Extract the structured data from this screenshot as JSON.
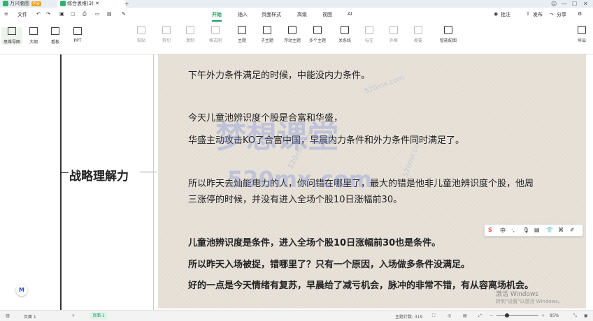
{
  "titlebar": {
    "app_tab": "万兴脑图",
    "pro_badge": "Pro",
    "doc_tab": "综合思维(3)",
    "add_tab": "+"
  },
  "menubar": {
    "file": "文件",
    "tabs": [
      "开始",
      "插入",
      "页面样式",
      "高级",
      "视图",
      "AI"
    ],
    "active_tab": "开始",
    "right": {
      "review": "批注",
      "publish": "发布",
      "share": "分享"
    }
  },
  "toolbar": {
    "views": [
      "思维导图",
      "大纲",
      "看板",
      "PPT"
    ],
    "tools": [
      "粘贴",
      "剪切",
      "复制",
      "格式刷",
      "主题",
      "子主题",
      "浮动主题",
      "多个主题",
      "关系线",
      "标注",
      "外框",
      "概要",
      "智能配图"
    ],
    "export": "导出"
  },
  "node": {
    "label": "战略理解力"
  },
  "note": {
    "lines": [
      "下午外力条件满足的时候，中能没内力条件。",
      "今天儿童池辨识度个股是合富和华盛，",
      "华盛主动攻击KO了合富中国，早晨内力条件和外力条件同时满足了。",
      "所以昨天去灿能电力的人，你问错在哪里了，最大的错是他非儿童池辨识度个股，他周",
      "三涨停的时候，并没有进入全场个股10日涨幅前30。",
      "儿童池辨识度是条件，进入全场个股10日涨幅前30也是条件。",
      "所以昨天入场被捉，错哪里了？只有一个原因，入场做多条件没满足。",
      "好的一点是今天情绪有复苏，早晨给了减亏机会，脉冲的非常不错，有从容离场机会。"
    ]
  },
  "watermark": {
    "big": "梦想课堂",
    "url": "520mx.com",
    "small": "520mx.com"
  },
  "floatbar": {
    "items": [
      "S",
      "中",
      "·,",
      "🎙",
      "▤",
      "👕",
      "⌘",
      "✐"
    ]
  },
  "statusbar": {
    "page_label": "页面 1",
    "page_chip": "页面-1",
    "word_count": "主题计数: 319",
    "zoom": "85%"
  },
  "windows": {
    "activate": "激活 Windows",
    "activate_sub": "转到\"设置\"以激活 Windows。"
  }
}
